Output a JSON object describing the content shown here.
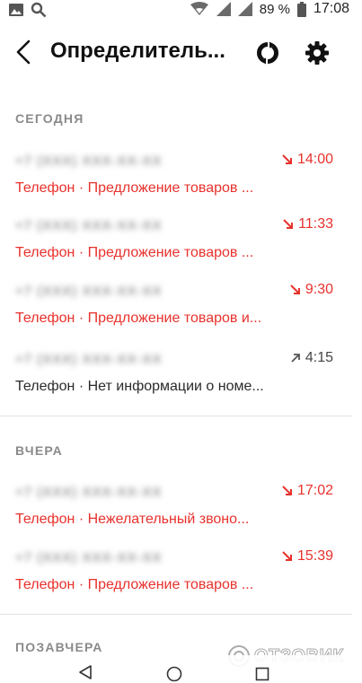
{
  "status_bar": {
    "battery": "89 %",
    "time": "17:08",
    "icons": [
      "image-icon",
      "search-icon",
      "wifi-icon",
      "signal-icon",
      "signal-icon",
      "battery-icon"
    ]
  },
  "app_bar": {
    "title": "Определитель...",
    "icons": [
      "back-arrow-icon",
      "refresh-icon",
      "gear-icon"
    ]
  },
  "sections": [
    {
      "header": "СЕГОДНЯ",
      "calls": [
        {
          "number": "+7 (XXX) XXX-XX-XX",
          "description": "Телефон · Предложение товаров ...",
          "time": "14:00",
          "direction": "missed",
          "color": "#e8312c"
        },
        {
          "number": "+7 (XXX) XXX-XX-XX",
          "description": "Телефон · Предложение товаров ...",
          "time": "11:33",
          "direction": "missed",
          "color": "#e8312c"
        },
        {
          "number": "+7 (XXX) XXX-XX-XX",
          "description": "Телефон · Предложение товаров и...",
          "time": "9:30",
          "direction": "missed",
          "color": "#e8312c"
        },
        {
          "number": "+7 (XXX) XXX-XX-XX",
          "description": "Телефон · Нет информации о номе...",
          "time": "4:15",
          "direction": "outgoing",
          "color": "#444444"
        }
      ]
    },
    {
      "header": "ВЧЕРА",
      "calls": [
        {
          "number": "+7 (XXX) XXX-XX-XX",
          "description": "Телефон · Нежелательный звоно...",
          "time": "17:02",
          "direction": "missed",
          "color": "#e8312c"
        },
        {
          "number": "+7 (XXX) XXX-XX-XX",
          "description": "Телефон · Предложение товаров ...",
          "time": "15:39",
          "direction": "missed",
          "color": "#e8312c"
        }
      ]
    },
    {
      "header": "ПОЗАВЧЕРА",
      "calls": []
    }
  ],
  "watermark": "ОТЗОВИК",
  "nav_bar": {
    "icons": [
      "nav-back-icon",
      "nav-home-icon",
      "nav-recents-icon"
    ]
  },
  "colors": {
    "accent_red": "#e8312c",
    "section_header": "#8a8a8a",
    "divider": "#e2e2e2"
  }
}
